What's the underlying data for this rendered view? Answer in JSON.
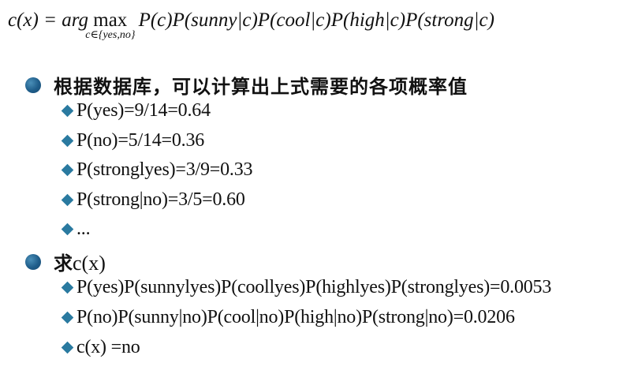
{
  "formula": {
    "lhs": "c(x) = arg",
    "op": "max",
    "subscript": "c∈{yes,no}",
    "rhs": "P(c)P(sunny|c)P(cool|c)P(high|c)P(strong|c)"
  },
  "section1": {
    "title": "根据数据库，可以计算出上式需要的各项概率值",
    "items": [
      "P(yes)=9/14=0.64",
      "P(no)=5/14=0.36",
      "P(stronglyes)=3/9=0.33",
      "P(strong|no)=3/5=0.60",
      "..."
    ]
  },
  "section2": {
    "title_cn": "求",
    "title_math": "c(x)",
    "items": [
      "P(yes)P(sunnylyes)P(coollyes)P(highlyes)P(stronglyes)=0.0053",
      "P(no)P(sunny|no)P(cool|no)P(high|no)P(strong|no)=0.0206",
      "c(x) =no"
    ]
  },
  "colors": {
    "bullet": "#1f5d8a",
    "diamond": "#2a7aa0",
    "text": "#111111"
  },
  "icons": {
    "main_bullet": "filled-circle-bullet",
    "sub_bullet": "diamond-bullet"
  }
}
